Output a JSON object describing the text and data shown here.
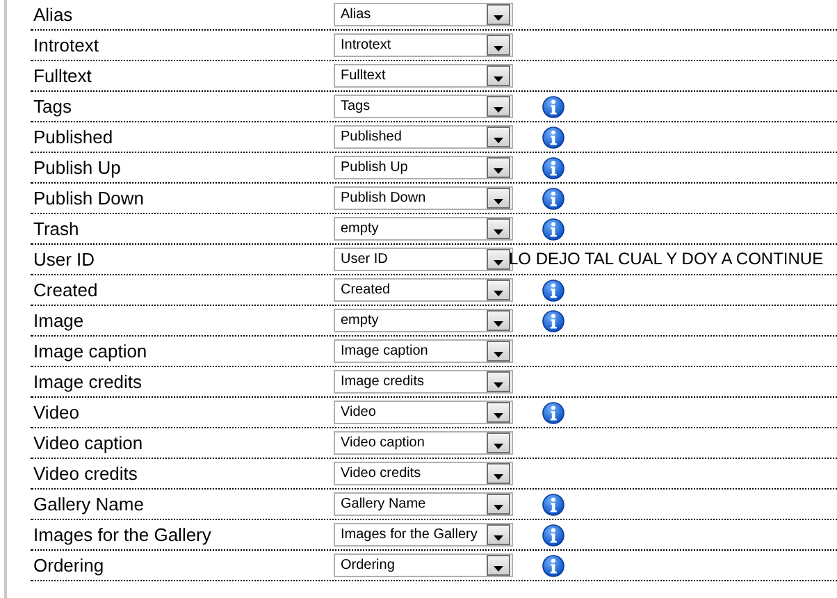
{
  "rows": [
    {
      "label": "Alias",
      "value": "Alias",
      "info": false
    },
    {
      "label": "Introtext",
      "value": "Introtext",
      "info": false
    },
    {
      "label": "Fulltext",
      "value": "Fulltext",
      "info": false
    },
    {
      "label": "Tags",
      "value": "Tags",
      "info": true
    },
    {
      "label": "Published",
      "value": "Published",
      "info": true
    },
    {
      "label": "Publish Up",
      "value": "Publish Up",
      "info": true
    },
    {
      "label": "Publish Down",
      "value": "Publish Down",
      "info": true
    },
    {
      "label": "Trash",
      "value": "empty",
      "info": true
    },
    {
      "label": "User ID",
      "value": "User ID",
      "info": false,
      "note": "LO DEJO TAL CUAL Y DOY A CONTINUE"
    },
    {
      "label": "Created",
      "value": "Created",
      "info": true
    },
    {
      "label": "Image",
      "value": "empty",
      "info": true
    },
    {
      "label": "Image caption",
      "value": "Image caption",
      "info": false
    },
    {
      "label": "Image credits",
      "value": "Image credits",
      "info": false
    },
    {
      "label": "Video",
      "value": "Video",
      "info": true
    },
    {
      "label": "Video caption",
      "value": "Video caption",
      "info": false
    },
    {
      "label": "Video credits",
      "value": "Video credits",
      "info": false
    },
    {
      "label": "Gallery Name",
      "value": "Gallery Name",
      "info": true
    },
    {
      "label": "Images for the Gallery",
      "value": "Images for the Gallery",
      "info": true
    },
    {
      "label": "Ordering",
      "value": "Ordering",
      "info": true
    }
  ]
}
